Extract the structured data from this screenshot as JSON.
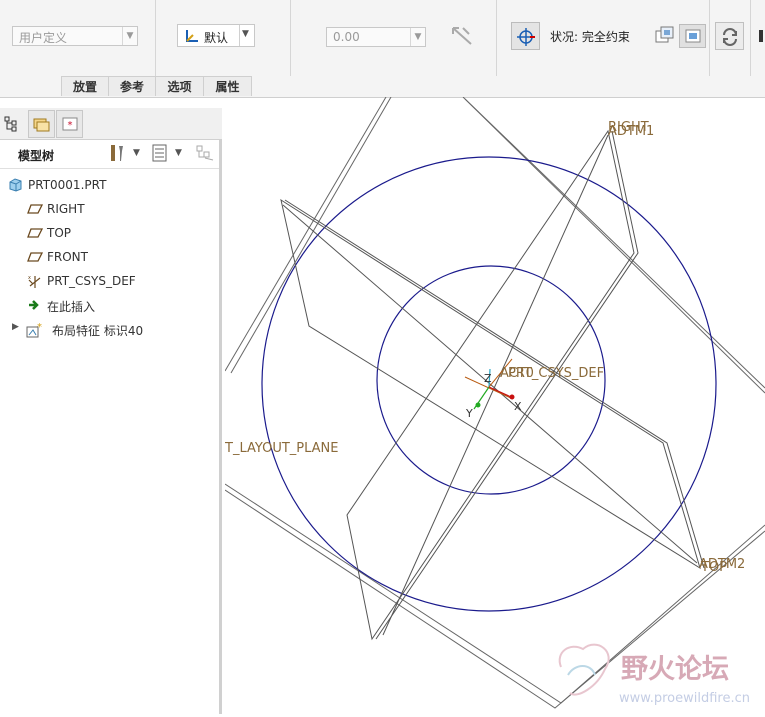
{
  "ribbon": {
    "filter_combo": "用户定义",
    "view_button": "默认",
    "value_field": "0.00",
    "status": "状况: 完全约束"
  },
  "tabs": [
    {
      "label": "放置"
    },
    {
      "label": "参考"
    },
    {
      "label": "选项"
    },
    {
      "label": "属性"
    }
  ],
  "model_tree": {
    "title": "模型树",
    "items": [
      {
        "label": "PRT0001.PRT",
        "icon": "part-icon"
      },
      {
        "label": "RIGHT",
        "icon": "datum-plane-icon"
      },
      {
        "label": "TOP",
        "icon": "datum-plane-icon"
      },
      {
        "label": "FRONT",
        "icon": "datum-plane-icon"
      },
      {
        "label": "PRT_CSYS_DEF",
        "icon": "csys-icon"
      },
      {
        "label": "在此插入",
        "icon": "insert-arrow-icon"
      },
      {
        "label": "布局特征 标识40",
        "icon": "layout-feature-icon"
      }
    ]
  },
  "viewport": {
    "labels": {
      "right": "RIGHT",
      "adtm1": "ADTM1",
      "csys": "PRT_CSYS_DEF",
      "act0": "ACT0",
      "layout_plane": "T_LAYOUT_PLANE",
      "adtm2": "ADTM2",
      "top": "TOP",
      "axis_x": "X",
      "axis_y": "Y",
      "axis_z": "Z"
    },
    "watermark": {
      "brand": "野火论坛",
      "url": "www.proewildfire.cn"
    },
    "colors": {
      "circle": "#1a1a8c",
      "plane": "#555555",
      "label": "#8a6a3a",
      "watermark": "#e0b8c0"
    }
  }
}
